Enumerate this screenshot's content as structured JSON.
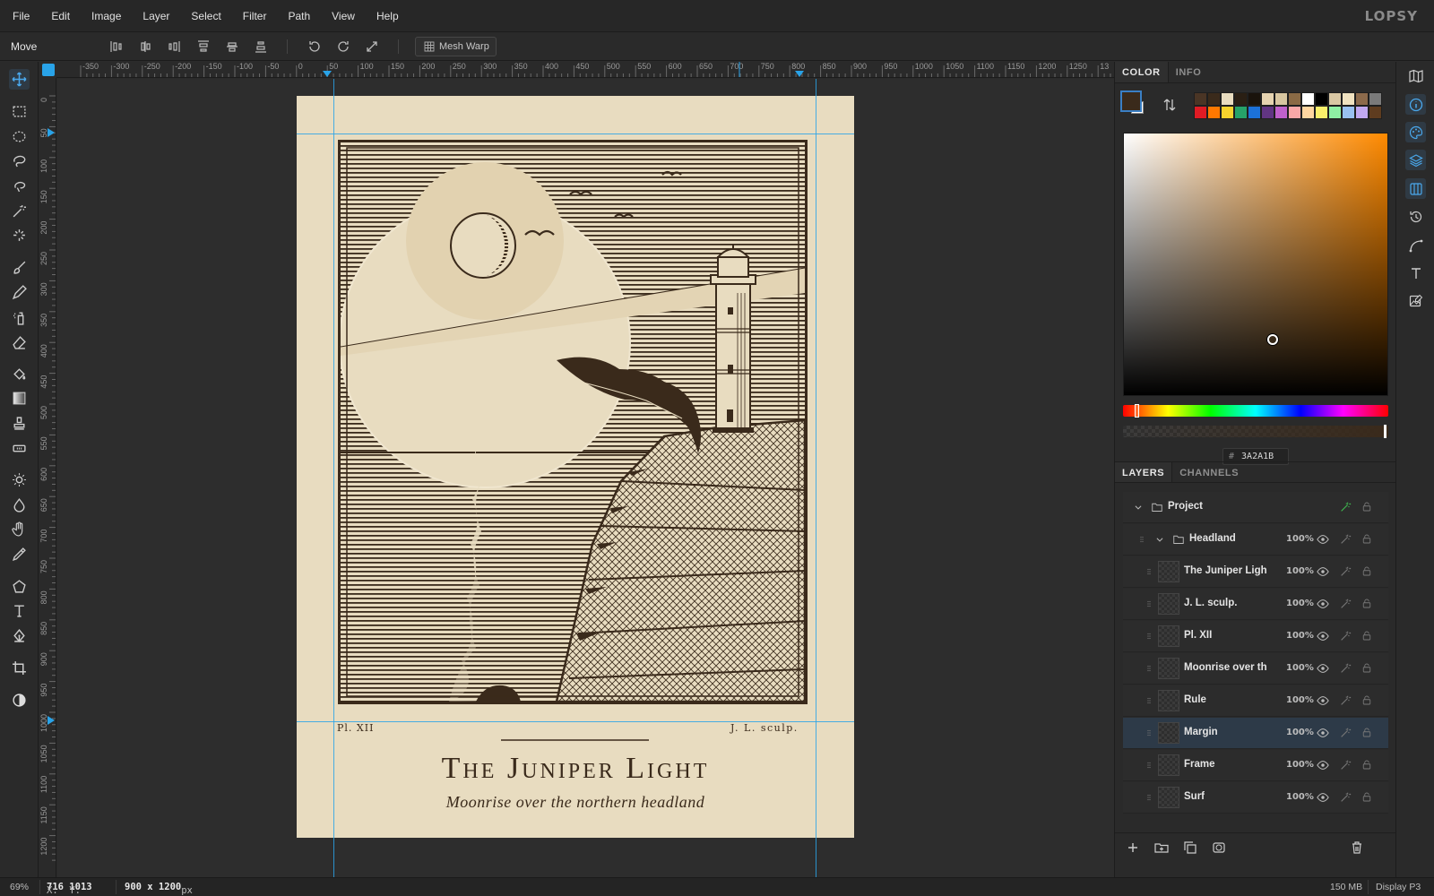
{
  "app": {
    "logo": "LOPSY"
  },
  "menu": [
    "File",
    "Edit",
    "Image",
    "Layer",
    "Select",
    "Filter",
    "Path",
    "View",
    "Help"
  ],
  "options": {
    "tool_name": "Move",
    "mesh_warp_label": "Mesh Warp"
  },
  "tools": [
    "move-tool",
    "rect-select-tool",
    "ellipse-select-tool",
    "lasso-tool",
    "magnetic-lasso-tool",
    "magic-wand-tool",
    "quick-select-tool",
    "brush-tool",
    "pencil-tool",
    "spray-tool",
    "eraser-tool",
    "fill-tool",
    "gradient-tool",
    "stamp-tool",
    "healing-tool",
    "dodge-tool",
    "burn-tool",
    "smudge-tool",
    "eyedropper-tool",
    "shape-tool",
    "text-tool",
    "pen-tool",
    "crop-tool",
    "contrast-tool"
  ],
  "rulers": {
    "h_labels": [
      "-350",
      "-300",
      "-250",
      "-200",
      "-150",
      "-100",
      "-50",
      "0",
      "50",
      "100",
      "150",
      "200",
      "250",
      "300",
      "350",
      "400",
      "450",
      "500",
      "550",
      "600",
      "650",
      "700",
      "750",
      "800",
      "850",
      "900",
      "950",
      "1000",
      "1050",
      "1100",
      "1150",
      "1200",
      "1250",
      "13"
    ],
    "v_labels": [
      "0",
      "50",
      "100",
      "150",
      "200",
      "250",
      "300",
      "350",
      "400",
      "450",
      "500",
      "550",
      "600",
      "650",
      "700",
      "750",
      "800",
      "850",
      "900",
      "950",
      "1000",
      "1050",
      "1100",
      "1150",
      "1200"
    ]
  },
  "artwork": {
    "plate": "Pl. XII",
    "sculptor": "J. L. sculp.",
    "title": "The Juniper Light",
    "subtitle": "Moonrise over the northern headland"
  },
  "color_panel": {
    "tabs": [
      "COLOR",
      "INFO"
    ],
    "active_tab": "COLOR",
    "foreground": "#3a2a1b",
    "background": "#ffffff",
    "hex_label": "#",
    "hex_value": "3A2A1B",
    "swatches": [
      "#4a3525",
      "#3a2a1b",
      "#e8dcc0",
      "#2a1f14",
      "#1a130c",
      "#e5d3b0",
      "#d8c6a0",
      "#8a6a45",
      "#ffffff",
      "#000000",
      "#d9c7a3",
      "#f0e2c0",
      "#8c6a4b",
      "#7a7a7a",
      "#e01b24",
      "#ff7800",
      "#f6d32d",
      "#26a269",
      "#1c71d8",
      "#613583",
      "#c061cb",
      "#f9a8a8",
      "#ffd6a0",
      "#f9f06b",
      "#8ff0a4",
      "#99c1f1",
      "#c0a8f0",
      "#5e3c1f"
    ]
  },
  "layers_panel": {
    "tabs": [
      "LAYERS",
      "CHANNELS"
    ],
    "active_tab": "LAYERS",
    "layers": [
      {
        "name": "Project",
        "kind": "group",
        "level": 0,
        "opacity": ""
      },
      {
        "name": "Headland",
        "kind": "group",
        "level": 1,
        "opacity": "100%"
      },
      {
        "name": "The Juniper Ligh",
        "kind": "layer",
        "level": 2,
        "opacity": "100%"
      },
      {
        "name": "J. L. sculp.",
        "kind": "layer",
        "level": 2,
        "opacity": "100%"
      },
      {
        "name": "Pl. XII",
        "kind": "layer",
        "level": 2,
        "opacity": "100%"
      },
      {
        "name": "Moonrise over th",
        "kind": "layer",
        "level": 2,
        "opacity": "100%"
      },
      {
        "name": "Rule",
        "kind": "layer",
        "level": 2,
        "opacity": "100%"
      },
      {
        "name": "Margin",
        "kind": "layer",
        "level": 2,
        "opacity": "100%",
        "selected": true
      },
      {
        "name": "Frame",
        "kind": "layer",
        "level": 2,
        "opacity": "100%"
      },
      {
        "name": "Surf",
        "kind": "layer",
        "level": 2,
        "opacity": "100%"
      }
    ]
  },
  "status": {
    "zoom": "69%",
    "x_label": "X:",
    "x_value": "716",
    "y_label": "Y:",
    "y_value": "1013",
    "doc_size": "900 x 1200",
    "doc_unit": "px",
    "memory": "150 MB",
    "color_profile": "Display P3"
  },
  "colors": {
    "accent": "#29a3e8",
    "ink": "#3a2a1b",
    "paper": "#e8dcc0",
    "selected_row": "#2d3a48"
  }
}
